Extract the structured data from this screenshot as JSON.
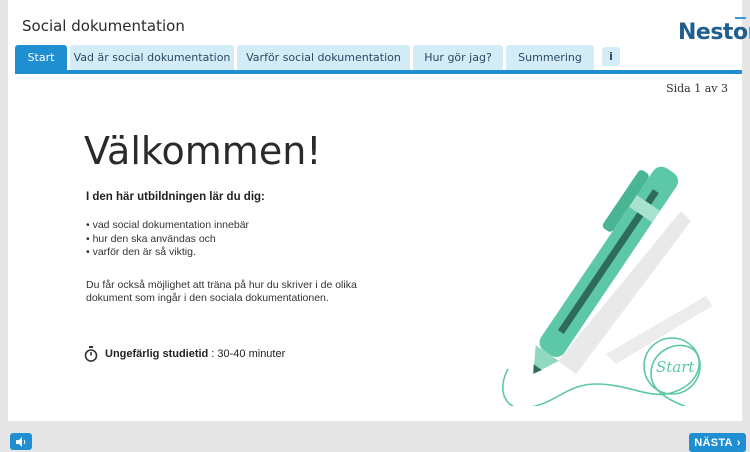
{
  "app": {
    "title": "Social dokumentation",
    "logo": "Nestor"
  },
  "tabs": [
    {
      "label": "Start",
      "active": true
    },
    {
      "label": "Vad är social dokumentation",
      "active": false
    },
    {
      "label": "Varför social dokumentation",
      "active": false
    },
    {
      "label": "Hur gör jag?",
      "active": false
    },
    {
      "label": "Summering",
      "active": false
    },
    {
      "label": "i",
      "active": false
    }
  ],
  "page": {
    "counter": "Sida 1 av 3",
    "heading": "Välkommen!",
    "intro": "I den här utbildningen lär du dig:",
    "bullets": [
      "vad social dokumentation innebär",
      "hur den ska användas och",
      "varför den är så viktig."
    ],
    "paragraph": "Du får också möjlighet att träna på hur du skriver i de olika dokument som ingår i den sociala dokumentationen.",
    "duration_label": "Ungefärlig studietid",
    "duration_value": ": 30-40 minuter",
    "illustration_text": "Start"
  },
  "footer": {
    "next_label": "NÄSTA"
  },
  "colors": {
    "accent": "#1f8fd1",
    "tab_inactive": "#d4ecf8",
    "pen_green": "#5cc8a8"
  },
  "icons": {
    "stopwatch": "stopwatch-icon",
    "audio": "speaker-icon",
    "next": "chevron-right-icon"
  }
}
